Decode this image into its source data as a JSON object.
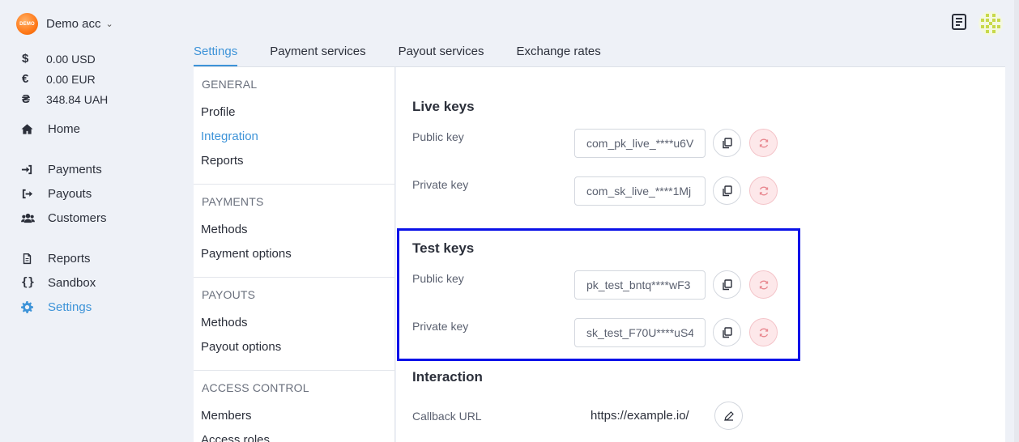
{
  "account": {
    "logo_text": "DEMO",
    "name": "Demo acc"
  },
  "balances": [
    {
      "symbol": "$",
      "amount": "0.00 USD"
    },
    {
      "symbol": "€",
      "amount": "0.00 EUR"
    },
    {
      "symbol": "₴",
      "amount": "348.84 UAH"
    }
  ],
  "nav": {
    "home": "Home",
    "payments": "Payments",
    "payouts": "Payouts",
    "customers": "Customers",
    "reports": "Reports",
    "sandbox": "Sandbox",
    "settings": "Settings"
  },
  "tabs": [
    "Settings",
    "Payment services",
    "Payout services",
    "Exchange rates"
  ],
  "menu": {
    "general": {
      "head": "GENERAL",
      "items": [
        "Profile",
        "Integration",
        "Reports"
      ]
    },
    "payments": {
      "head": "PAYMENTS",
      "items": [
        "Methods",
        "Payment options"
      ]
    },
    "payouts": {
      "head": "PAYOUTS",
      "items": [
        "Methods",
        "Payout options"
      ]
    },
    "access": {
      "head": "ACCESS CONTROL",
      "items": [
        "Members",
        "Access roles"
      ]
    }
  },
  "live_keys": {
    "title": "Live keys",
    "public_label": "Public key",
    "public_value": "com_pk_live_****u6V",
    "private_label": "Private key",
    "private_value": "com_sk_live_****1Mj"
  },
  "test_keys": {
    "title": "Test keys",
    "public_label": "Public key",
    "public_value": "pk_test_bntq****wF3",
    "private_label": "Private key",
    "private_value": "sk_test_F70U****uS4"
  },
  "interaction": {
    "title": "Interaction",
    "callback_label": "Callback URL",
    "callback_value": "https://example.io/"
  },
  "colors": {
    "accent": "#3d93d8",
    "highlight": "#0a12e8",
    "regen_bg": "#fde8ea",
    "regen_icon": "#e8878f"
  }
}
